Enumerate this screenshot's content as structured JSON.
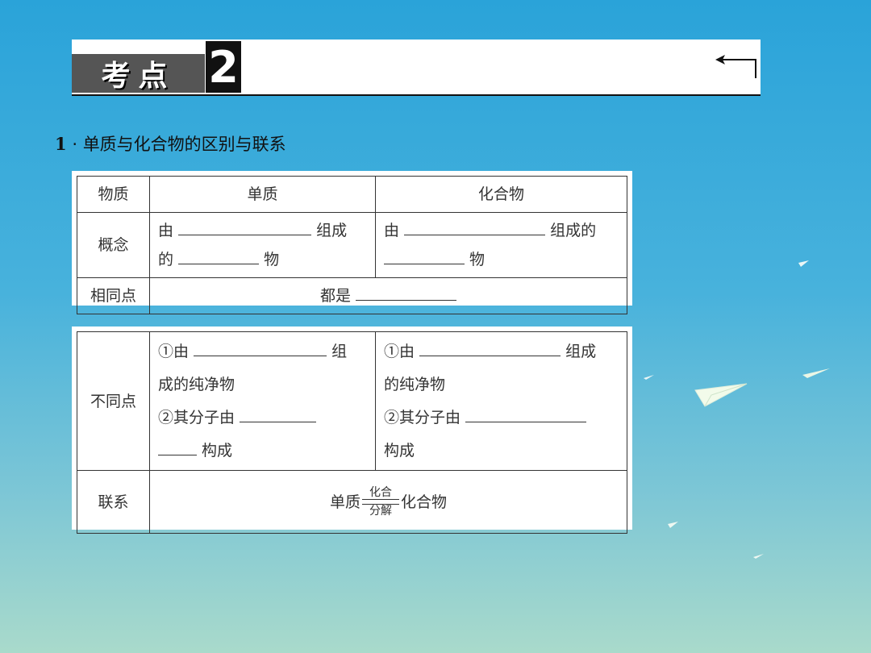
{
  "banner": {
    "label": "考点",
    "number": "2"
  },
  "heading": {
    "number": "1",
    "separator": "·",
    "text": "单质与化合物的区别与联系"
  },
  "table1": {
    "headers": [
      "物质",
      "单质",
      "化合物"
    ],
    "concept": {
      "label": "概念",
      "single_a": "由",
      "single_b": "组成",
      "single_c": "的",
      "single_d": "物",
      "compound_a": "由",
      "compound_b": "组成的",
      "compound_c": "物"
    },
    "common": {
      "label": "相同点",
      "text": "都是"
    }
  },
  "table2": {
    "diff": {
      "label": "不同点",
      "single_1a": "①由",
      "single_1b": "组",
      "single_1c": "成的纯净物",
      "single_2a": "②其分子由",
      "single_2b": "构成",
      "compound_1a": "①由",
      "compound_1b": "组成",
      "compound_1c": "的纯净物",
      "compound_2a": "②其分子由",
      "compound_2b": "构成"
    },
    "relation": {
      "label": "联系",
      "left": "单质",
      "top": "化合",
      "bottom": "分解",
      "right": "化合物"
    }
  }
}
